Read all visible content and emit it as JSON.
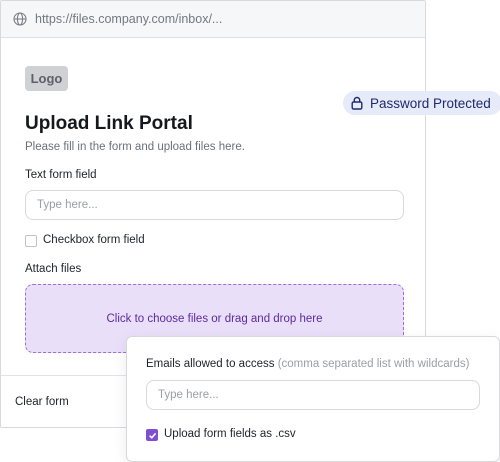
{
  "browser": {
    "url": "https://files.company.com/inbox/...",
    "globe_icon": "globe-icon"
  },
  "logo": {
    "text": "Logo"
  },
  "badge": {
    "label": "Password Protected",
    "icon": "lock-icon",
    "bg": "#e7eaf9",
    "fg": "#1d2a6e"
  },
  "page": {
    "title": "Upload Link Portal",
    "subtitle": "Please fill in the form and upload files here."
  },
  "form": {
    "text_field_label": "Text form field",
    "text_field_placeholder": "Type here...",
    "checkbox_label": "Checkbox form field",
    "checkbox_checked": false,
    "attach_label": "Attach files",
    "dropzone_text": "Click to choose files or drag and drop here",
    "clear_label": "Clear form"
  },
  "settings": {
    "emails_label": "Emails allowed to access",
    "emails_hint": "(comma separated list with wildcards)",
    "emails_placeholder": "Type here...",
    "csv_label": "Upload form fields as .csv",
    "csv_checked": true
  },
  "colors": {
    "accent": "#7f4fcf",
    "dropzone_bg": "#eadff9",
    "dropzone_border": "#9b6fdc",
    "dropzone_text": "#5b2a9e"
  }
}
